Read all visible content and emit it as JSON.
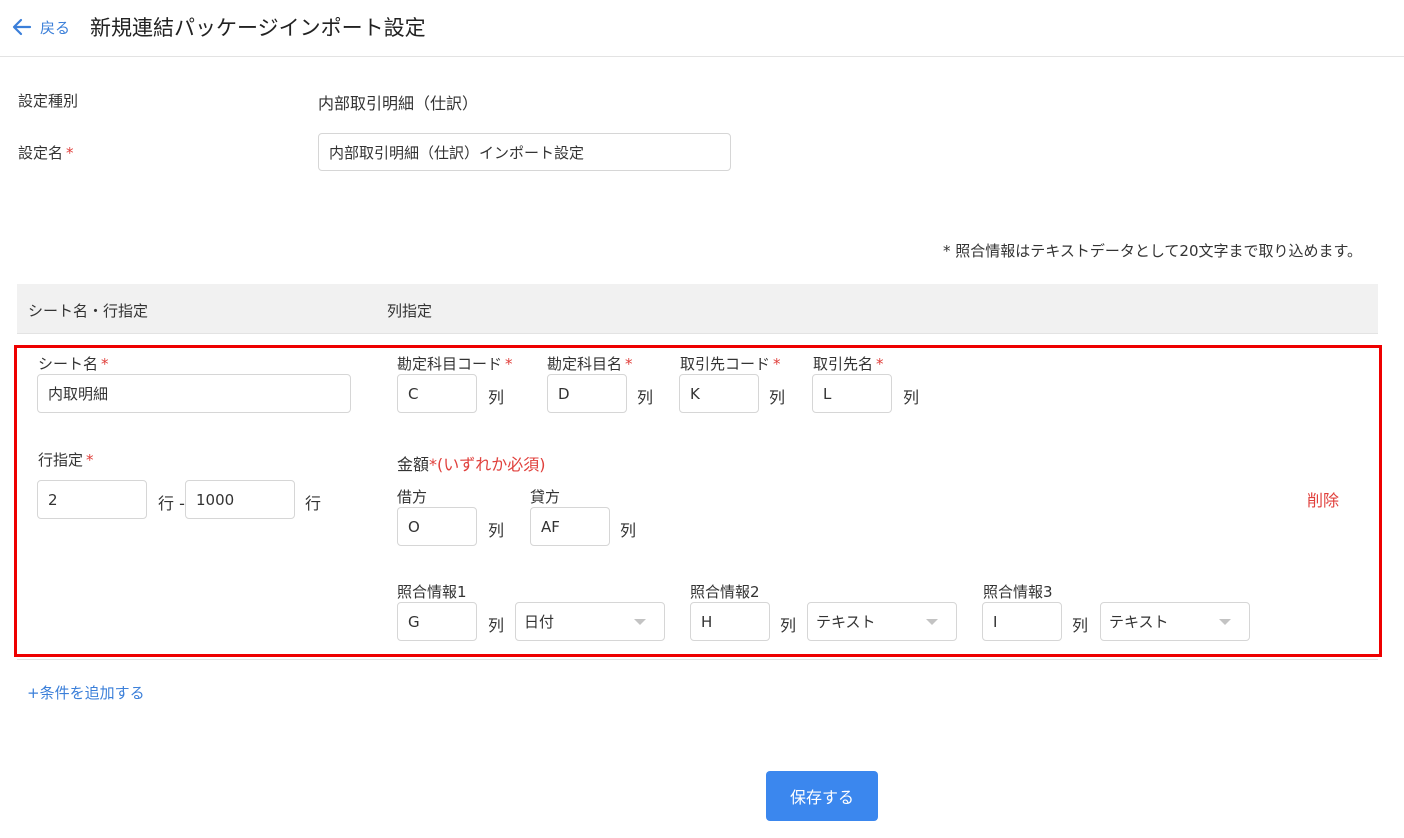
{
  "header": {
    "back_label": "戻る",
    "title": "新規連結パッケージインポート設定"
  },
  "form": {
    "type_label": "設定種別",
    "type_value": "内部取引明細（仕訳）",
    "name_label": "設定名",
    "name_value": "内部取引明細（仕訳）インポート設定",
    "required_mark": "*"
  },
  "note": "* 照合情報はテキストデータとして20文字まで取り込めます。",
  "table": {
    "headers": [
      "シート名・行指定",
      "列指定"
    ],
    "row": {
      "sheet_label": "シート名",
      "sheet_value": "内取明細",
      "rows_label": "行指定",
      "row_start": "2",
      "row_sep": "行 -",
      "row_end": "1000",
      "row_unit": "行",
      "col_unit": "列",
      "columns": [
        {
          "label": "勘定科目コード",
          "value": "C"
        },
        {
          "label": "勘定科目名",
          "value": "D"
        },
        {
          "label": "取引先コード",
          "value": "K"
        },
        {
          "label": "取引先名",
          "value": "L"
        }
      ],
      "amount": {
        "label": "金額",
        "note": "(いずれか必須)",
        "debit_label": "借方",
        "debit_value": "O",
        "credit_label": "貸方",
        "credit_value": "AF"
      },
      "matching": [
        {
          "label": "照合情報1",
          "value": "G",
          "type": "日付"
        },
        {
          "label": "照合情報2",
          "value": "H",
          "type": "テキスト"
        },
        {
          "label": "照合情報3",
          "value": "I",
          "type": "テキスト"
        }
      ],
      "delete_label": "削除"
    }
  },
  "add_condition_label": "+条件を追加する",
  "save_label": "保存する",
  "colors": {
    "accent": "#3b87ee",
    "link": "#3b7fd9",
    "required": "#e0403c",
    "highlight_border": "#ee0000"
  }
}
